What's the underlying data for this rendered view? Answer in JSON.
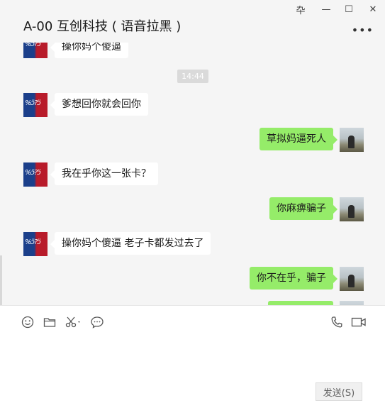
{
  "window": {
    "title": "A-00 互创科技 ( 语音拉黑 )",
    "controls": {
      "pin": "卆",
      "minimize": "—",
      "maximize": "☐",
      "close": "✕"
    },
    "more_label": "•••"
  },
  "chat": {
    "timestamp": "14:44",
    "messages": [
      {
        "side": "left",
        "text": "操你妈个傻逼"
      },
      {
        "side": "left",
        "text": "爹想回你就会回你"
      },
      {
        "side": "right",
        "text": "草拟妈逼死人"
      },
      {
        "side": "left",
        "text": "我在乎你这一张卡？"
      },
      {
        "side": "right",
        "text": "你麻痹骗子"
      },
      {
        "side": "left",
        "text": "操你妈个傻逼 老子卡都发过去了"
      },
      {
        "side": "right",
        "text": "你不在乎，骗子"
      },
      {
        "side": "right",
        "text": ""
      }
    ],
    "avatar_left_text": "%ɔ̈?ɔ̈"
  },
  "toolbar": {
    "icons": [
      "emoji-icon",
      "folder-icon",
      "scissors-icon",
      "chat-history-icon",
      "phone-icon",
      "video-icon"
    ],
    "send_label": "发送(S)"
  },
  "colors": {
    "outgoing_bubble": "#95ec69",
    "incoming_bubble": "#ffffff",
    "background": "#f5f5f5"
  }
}
